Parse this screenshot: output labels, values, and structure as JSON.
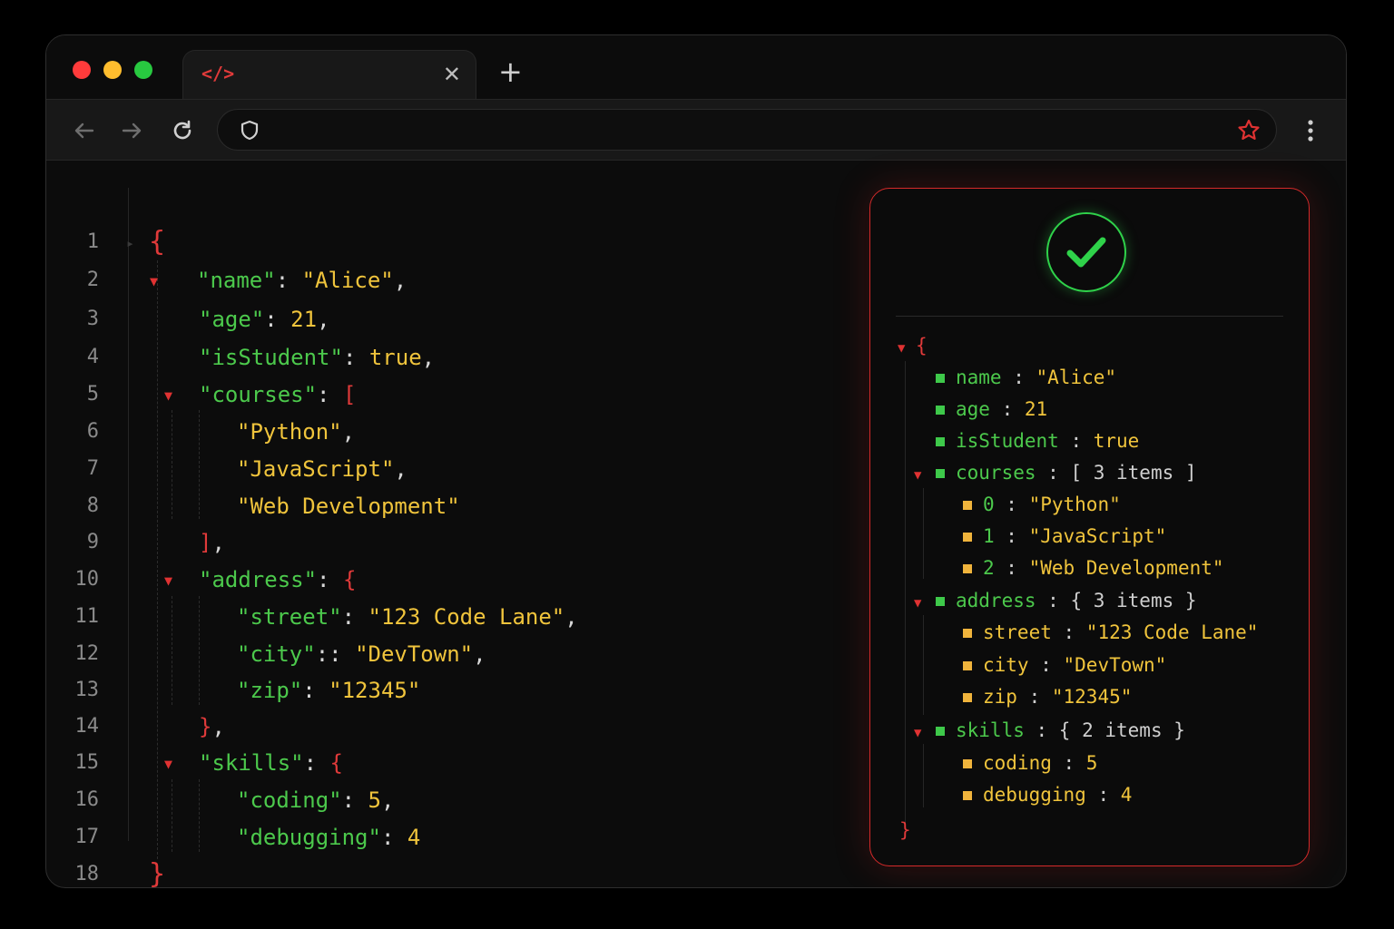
{
  "browser": {
    "tab_icon": "</>",
    "tab_close": "✕",
    "new_tab": "+",
    "icons": [
      "back-arrow-icon",
      "forward-arrow-icon",
      "reload-icon",
      "shield-icon",
      "star-icon",
      "kebab-menu-icon"
    ]
  },
  "editor": {
    "line_numbers": [
      "1",
      "2",
      "3",
      "4",
      "5",
      "6",
      "7",
      "8",
      "9",
      "10",
      "11",
      "12",
      "13",
      "14",
      "15",
      "16",
      "17",
      "18"
    ],
    "lines": [
      {
        "open": "{"
      },
      {
        "key": "\"name\"",
        "sep": ": ",
        "value": "\"Alice\"",
        "end": ","
      },
      {
        "key": "\"age\"",
        "sep": ": ",
        "value": "21",
        "end": ","
      },
      {
        "key": "\"isStudent\"",
        "sep": ": ",
        "value": "true",
        "end": ","
      },
      {
        "key": "\"courses\"",
        "sep": ": ",
        "bracket": "["
      },
      {
        "value": "\"Python\"",
        "end": ","
      },
      {
        "value": "\"JavaScript\"",
        "end": ","
      },
      {
        "value": "\"Web Development\""
      },
      {
        "close": "]",
        "end": ","
      },
      {
        "key": "\"address\"",
        "sep": ": ",
        "bracket": "{"
      },
      {
        "key": "\"street\"",
        "sep": ": ",
        "value": "\"123 Code Lane\"",
        "end": ","
      },
      {
        "key": "\"city\"",
        "sep": ":: ",
        "value": "\"DevTown\"",
        "end": ","
      },
      {
        "key": "\"zip\"",
        "sep": ": ",
        "value": "\"12345\""
      },
      {
        "close": "}",
        "end": ","
      },
      {
        "key": "\"skills\"",
        "sep": ": ",
        "bracket": "{"
      },
      {
        "key": "\"coding\"",
        "sep": ": ",
        "value": "5",
        "end": ","
      },
      {
        "key": "\"debugging\"",
        "sep": ": ",
        "value": "4"
      },
      {
        "close": "}"
      }
    ]
  },
  "viewer": {
    "status": "valid",
    "root_open": "{",
    "root_close": "}",
    "sep": " : ",
    "name": {
      "key": "name",
      "value": "\"Alice\""
    },
    "age": {
      "key": "age",
      "value": "21"
    },
    "isStudent": {
      "key": "isStudent",
      "value": "true"
    },
    "courses": {
      "key": "courses",
      "summary": "[ 3 items ]",
      "items": [
        {
          "key": "0",
          "value": "\"Python\""
        },
        {
          "key": "1",
          "value": "\"JavaScript\""
        },
        {
          "key": "2",
          "value": "\"Web Development\""
        }
      ]
    },
    "address": {
      "key": "address",
      "summary": "{ 3 items }",
      "items": [
        {
          "key": "street",
          "value": "\"123 Code Lane\""
        },
        {
          "key": "city",
          "value": "\"DevTown\""
        },
        {
          "key": "zip",
          "value": "\"12345\""
        }
      ]
    },
    "skills": {
      "key": "skills",
      "summary": "{ 2 items }",
      "items": [
        {
          "key": "coding",
          "value": "5"
        },
        {
          "key": "debugging",
          "value": "4"
        }
      ]
    }
  },
  "colors": {
    "key_green": "#4cc94c",
    "value_yellow": "#f0c43c",
    "bracket_red": "#e03a3a",
    "panel_border": "#d42a2a",
    "check_green": "#2fd24a"
  }
}
